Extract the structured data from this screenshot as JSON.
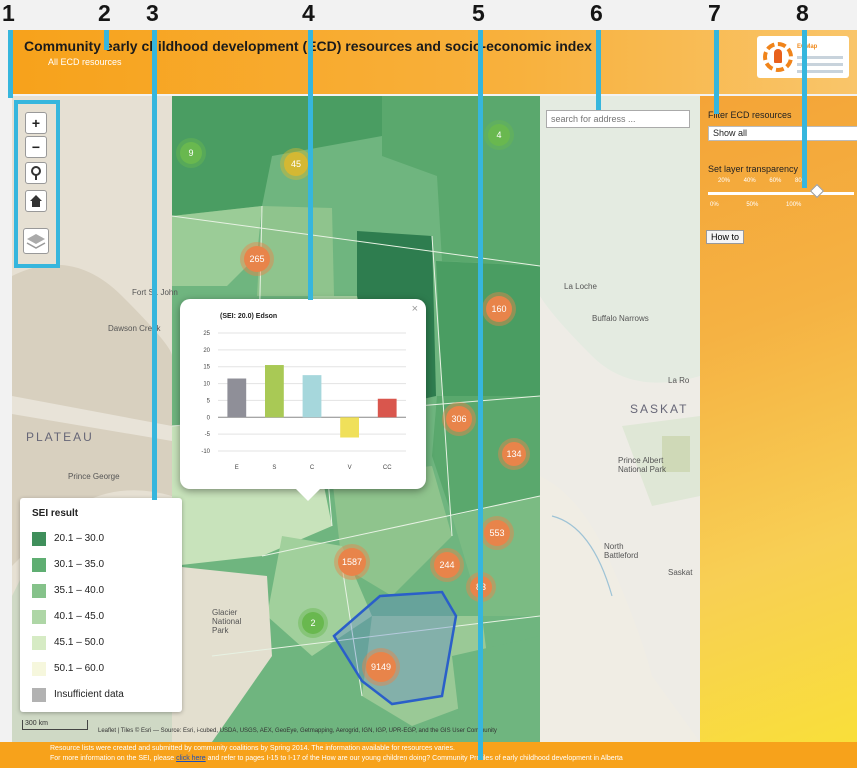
{
  "header": {
    "title": "Community early childhood development (ECD) resources and socio-economic index",
    "breadcrumb": "All ECD resources",
    "logo_text": "ECMap"
  },
  "callouts": [
    "1",
    "2",
    "3",
    "4",
    "5",
    "6",
    "7",
    "8"
  ],
  "map": {
    "zoom_in": "+",
    "zoom_out": "−",
    "search_placeholder": "search for address ...",
    "clusters": [
      "9",
      "45",
      "4",
      "265",
      "160",
      "306",
      "134",
      "553",
      "244",
      "1587",
      "83",
      "2",
      "9149"
    ],
    "places": [
      "Fort St. John",
      "Dawson Creek",
      "La Loche",
      "Buffalo Narrows",
      "La Ro",
      "SASKAT",
      "PLATEAU",
      "Prince George",
      "Prince Albert National Park",
      "North Battleford",
      "Saskat",
      "Glacier National Park"
    ],
    "scale_label": "300 km",
    "attribution": "Leaflet | Tiles © Esri — Source: Esri, i-cubed, USDA, USGS, AEX, GeoEye, Getmapping, Aerogrid, IGN, IGP, UPR-EGP, and the GIS User Community"
  },
  "popup": {
    "title": "(SEI: 20.0) Edson",
    "close": "×"
  },
  "chart_data": {
    "type": "bar",
    "title": "(SEI: 20.0) Edson",
    "categories": [
      "E",
      "S",
      "C",
      "V",
      "CC"
    ],
    "values": [
      11.5,
      15.5,
      12.5,
      -6,
      5.5
    ],
    "colors": [
      "#8f8f98",
      "#a9c955",
      "#a6d7dc",
      "#f0e05a",
      "#d9564d"
    ],
    "yticks": [
      "25",
      "20",
      "15",
      "10",
      "5",
      "0",
      "-5",
      "-10"
    ],
    "ylim": [
      -10,
      25
    ]
  },
  "legend": {
    "title": "SEI result",
    "items": [
      {
        "label": "20.1 – 30.0",
        "color": "#3f8f5b"
      },
      {
        "label": "30.1 – 35.0",
        "color": "#5fae72"
      },
      {
        "label": "35.1 – 40.0",
        "color": "#85c28a"
      },
      {
        "label": "40.1 – 45.0",
        "color": "#aed6a6"
      },
      {
        "label": "45.1 – 50.0",
        "color": "#d6ebc4"
      },
      {
        "label": "50.1 – 60.0",
        "color": "#f6f7dd"
      },
      {
        "label": "Insufficient data",
        "color": "#b2b2b2"
      }
    ]
  },
  "panel": {
    "filter_label": "Filter ECD resources",
    "filter_value": "Show all",
    "transparency_label": "Set layer transparency",
    "tick_top": "20% 40% 60% 80%",
    "tick_bottom": "0% 50% 100%",
    "how_to": "How to"
  },
  "footer": {
    "line1": "Resource lists were created and submitted by community coalitions by Spring 2014. The information available for resources varies.",
    "line2_a": "For more information on the SEI, please",
    "line2_link": "click here",
    "line2_b": "and refer to pages I-15 to I-17 of the How are our young children doing? Community Profiles of early childhood development in Alberta"
  }
}
